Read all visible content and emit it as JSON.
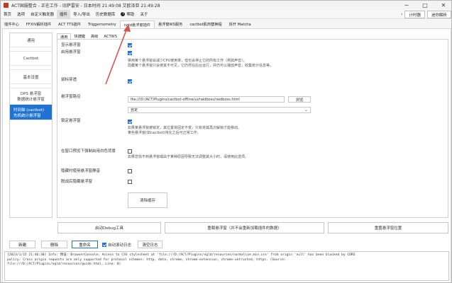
{
  "window": {
    "title": "ACT国服整合 - 正在工作 - 旧萨雷安 - 日本时间 21:49:08 艾欧泽亚 21:49:28"
  },
  "menubar": {
    "items": [
      "首页",
      "选项",
      "自定义触发器",
      "插件",
      "导入/导出",
      "历史数据库",
      "帮助",
      "关于"
    ],
    "right_buttons": {
      "back": "返回",
      "prev": "计时器",
      "next": "迷你解析"
    }
  },
  "tabs_top": [
    "插件中心",
    "FFXIV解析插件",
    "ACT TTS插件",
    "Triggernometry",
    "ngld悬浮窗插件",
    "悬浮窗WS服务",
    "cactbot肌肉替换程",
    "拆开 Matcha"
  ],
  "sidebar": {
    "items": [
      "通用",
      "Cactbot",
      "基本设置",
      "DPS 悬浮窗",
      "数据统计悬浮窗"
    ],
    "selected_line1": "时间轴 (cactbot)",
    "selected_line2": "先机统计悬浮窗"
  },
  "tabs_inner": [
    "通用",
    "快捷键",
    "高级",
    "ACTWS"
  ],
  "settings": {
    "show_overlay": "显示悬浮窗",
    "enable_overlay": "启用悬浮窗",
    "enable_note1": "禁用某个悬浮窗会减少CPU使用率，但也会停止它的所有工作（例如声音）。",
    "enable_note2": "隐藏某个悬浮窗只会使其不可见，它仍然在后台运行，并仍可以播放声音，收集统计信息等。",
    "click_through": "鼠标穿透",
    "path_label": "悬浮窗路径",
    "path_value": "file:///D:/ACT/Plugins/cactbot-offline/ui/raidboss/raidboss.html",
    "browse": "浏览",
    "preset_value": "自定",
    "lock_overlay": "锁定悬浮窗",
    "lock_note1": "如果某悬浮窗被锁定，其位置将固定不变，只有将其再次解锁才能移动。",
    "lock_note2": "某些悬浮窗(如cactbot)将在之后可正常工作。",
    "hide_on_fullscreen": "在窗口预览下强制启用白色背景",
    "hide_note": "如果您找不到悬浮窗或由于某种原因导致无法调整其大小时，请使用此选项。",
    "mute_hidden": "隐藏时使用悬浮窗静音",
    "hide_on_idle": "脱战后隐藏悬浮窗",
    "clear_cache": "清除缓存",
    "devtools": "启动Debug工具",
    "reload": "重载悬浮窗（并不会重新加载插件的数据）",
    "relocate": "重置悬浮窗位置"
  },
  "bottom": {
    "new": "新建",
    "delete": "删除",
    "rename": "重命名",
    "auto_hide": "自动滚动日志",
    "clear_log": "清空日志"
  },
  "log_lines": [
    "[2023/1/15 21:46:30] Info: 预设: BrowserConsole: Access to CSS stylesheet at 'file:///D:/ACT/Plugins/ngld/resources/normalize.min.css' from origin 'null' has been blocked by CORS",
    "policy: Cross origin requests are only supported for protocol schemes: http, data, chrome, chrome-extension, chrome-untrusted, https. (Source:",
    "file:///D:/ACT/Plugins/ngld/resources/guide.html, Line: 0)"
  ],
  "colors": {
    "accent": "#1f74d3",
    "annotation": "#d9534f"
  }
}
